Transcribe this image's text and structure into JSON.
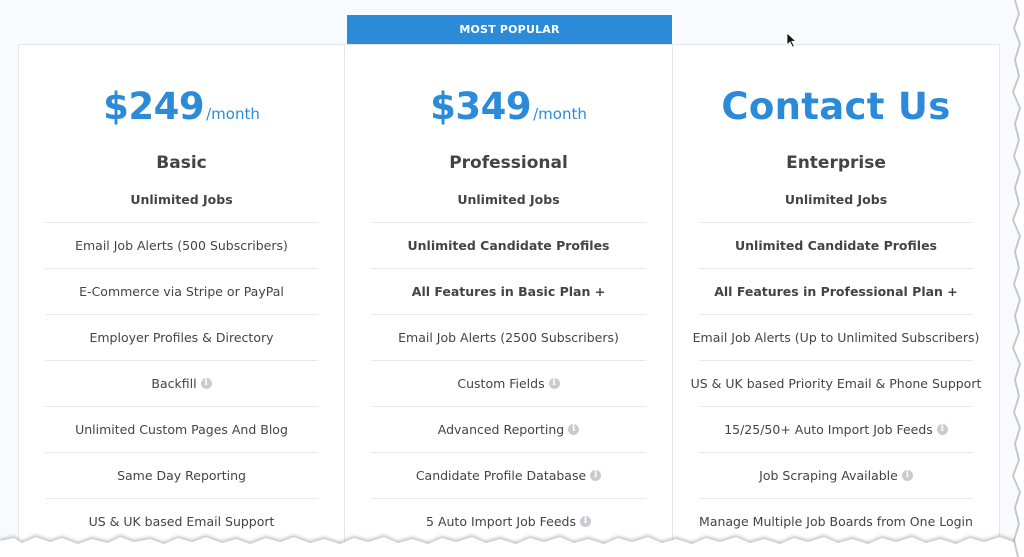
{
  "banner": {
    "label": "MOST POPULAR"
  },
  "plans": [
    {
      "amount": "$249",
      "per": "/month",
      "name": "Basic",
      "features": [
        {
          "label": "Unlimited Jobs",
          "bold": true,
          "info": false
        },
        {
          "label": "Email Job Alerts (500 Subscribers)",
          "bold": false,
          "info": false
        },
        {
          "label": "E-Commerce via Stripe or PayPal",
          "bold": false,
          "info": false
        },
        {
          "label": "Employer Profiles & Directory",
          "bold": false,
          "info": false
        },
        {
          "label": "Backfill",
          "bold": false,
          "info": true
        },
        {
          "label": "Unlimited Custom Pages And Blog",
          "bold": false,
          "info": false
        },
        {
          "label": "Same Day Reporting",
          "bold": false,
          "info": false
        },
        {
          "label": "US & UK based Email Support",
          "bold": false,
          "info": false
        }
      ]
    },
    {
      "amount": "$349",
      "per": "/month",
      "name": "Professional",
      "features": [
        {
          "label": "Unlimited Jobs",
          "bold": true,
          "info": false
        },
        {
          "label": "Unlimited Candidate Profiles",
          "bold": true,
          "info": false
        },
        {
          "label": "All Features in Basic Plan +",
          "bold": true,
          "info": false
        },
        {
          "label": "Email Job Alerts (2500 Subscribers)",
          "bold": false,
          "info": false
        },
        {
          "label": "Custom Fields",
          "bold": false,
          "info": true
        },
        {
          "label": "Advanced Reporting",
          "bold": false,
          "info": true
        },
        {
          "label": "Candidate Profile Database",
          "bold": false,
          "info": true
        },
        {
          "label": "5 Auto Import Job Feeds",
          "bold": false,
          "info": true
        }
      ]
    },
    {
      "amount": "Contact Us",
      "per": "",
      "name": "Enterprise",
      "features": [
        {
          "label": "Unlimited Jobs",
          "bold": true,
          "info": false
        },
        {
          "label": "Unlimited Candidate Profiles",
          "bold": true,
          "info": false
        },
        {
          "label": "All Features in Professional Plan +",
          "bold": true,
          "info": false
        },
        {
          "label": "Email Job Alerts (Up to Unlimited Subscribers)",
          "bold": false,
          "info": false
        },
        {
          "label": "US & UK based Priority Email & Phone Support",
          "bold": false,
          "info": false
        },
        {
          "label": "15/25/50+ Auto Import Job Feeds",
          "bold": false,
          "info": true
        },
        {
          "label": "Job Scraping Available",
          "bold": false,
          "info": true
        },
        {
          "label": "Manage Multiple Job Boards from One Login",
          "bold": false,
          "info": false
        }
      ]
    }
  ],
  "info_glyph": "i",
  "colors": {
    "accent": "#2b8bd9",
    "text": "#444444",
    "divider": "#e6e8eb"
  }
}
